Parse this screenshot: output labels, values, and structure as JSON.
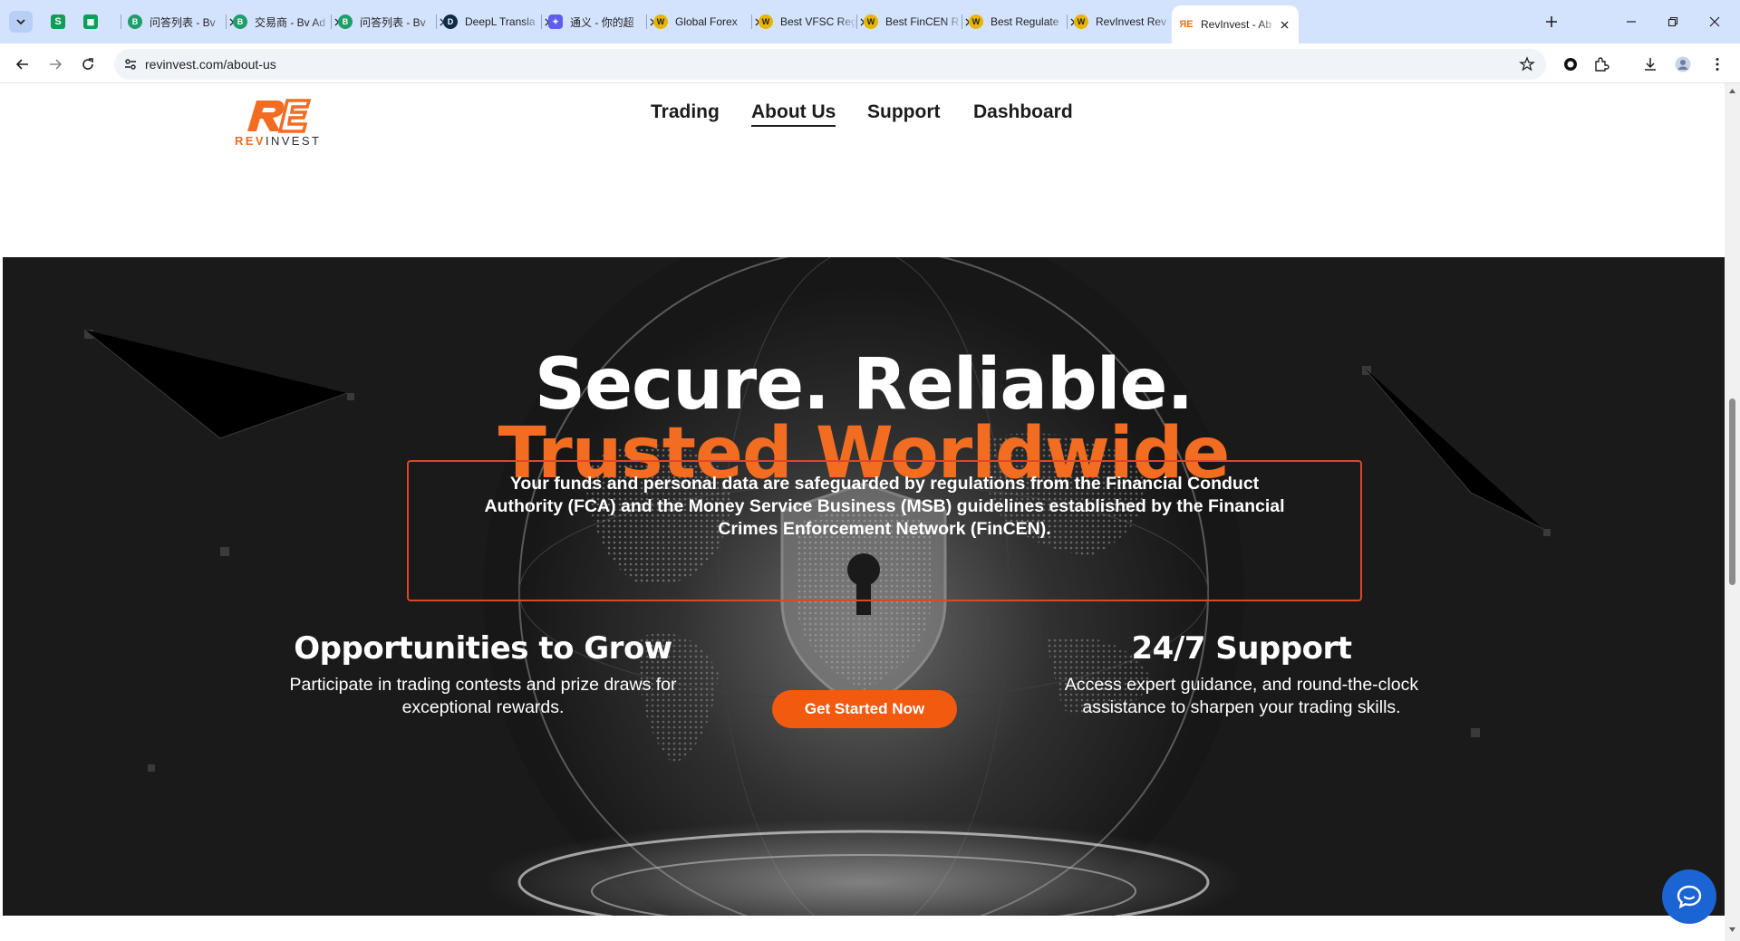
{
  "browser": {
    "pinned": [
      {
        "icon": "sheets-dropdown-icon",
        "label": ""
      },
      {
        "icon": "sheets-icon",
        "label": "S"
      },
      {
        "icon": "sheets-icon",
        "label": "⊞"
      }
    ],
    "tabs": [
      {
        "title": "问答列表 - Bv",
        "icon": "bv-icon",
        "color": "#1e9e6a"
      },
      {
        "title": "交易商 - Bv Ad",
        "icon": "bv-icon",
        "color": "#1e9e6a"
      },
      {
        "title": "问答列表 - Bv",
        "icon": "bv-icon",
        "color": "#1e9e6a"
      },
      {
        "title": "DeepL Transla",
        "icon": "deepl-icon",
        "color": "#0f2b46"
      },
      {
        "title": "通义 - 你的超",
        "icon": "tongyi-icon",
        "color": "#615ced"
      },
      {
        "title": "Global Forex",
        "icon": "wikifx-icon",
        "color": "#e8b400"
      },
      {
        "title": "Best VFSC Reg",
        "icon": "wikifx-icon",
        "color": "#e8b400"
      },
      {
        "title": "Best FinCEN R",
        "icon": "wikifx-icon",
        "color": "#e8b400"
      },
      {
        "title": "Best Regulate",
        "icon": "wikifx-icon",
        "color": "#e8b400"
      },
      {
        "title": "RevInvest Rev",
        "icon": "wikifx-icon",
        "color": "#e8b400"
      },
      {
        "title": "RevInvest - Ab",
        "icon": "revinvest-icon",
        "color": "#f26c21"
      }
    ],
    "url": "revinvest.com/about-us"
  },
  "site": {
    "logo_rev": "REV",
    "logo_invest": "INVEST",
    "menu": [
      "Trading",
      "About Us",
      "Support",
      "Dashboard"
    ],
    "active_menu": "About Us"
  },
  "hero": {
    "headline_white": "Secure. Reliable.",
    "headline_orange": "Trusted Worldwide",
    "notice_line1": "Your funds and personal data are safeguarded by regulations from the Financial Conduct",
    "notice_line2": "Authority (FCA) and the Money Service Business (MSB) guidelines established by the Financial",
    "notice_line3": "Crimes Enforcement Network (FinCEN).",
    "feature_left_title": "Opportunities to Grow",
    "feature_left_line1": "Participate in trading contests and prize draws for",
    "feature_left_line2": "exceptional rewards.",
    "feature_right_title": "24/7 Support",
    "feature_right_line1": "Access expert guidance, and round-the-clock",
    "feature_right_line2": "assistance to sharpen your trading skills.",
    "cta_label": "Get Started Now"
  },
  "colors": {
    "brand_orange": "#f26c21",
    "cta_orange": "#f25a10",
    "notice_border": "#e0452a",
    "chat_blue": "#1b64d4",
    "tabstrip": "#d3e3fd"
  }
}
